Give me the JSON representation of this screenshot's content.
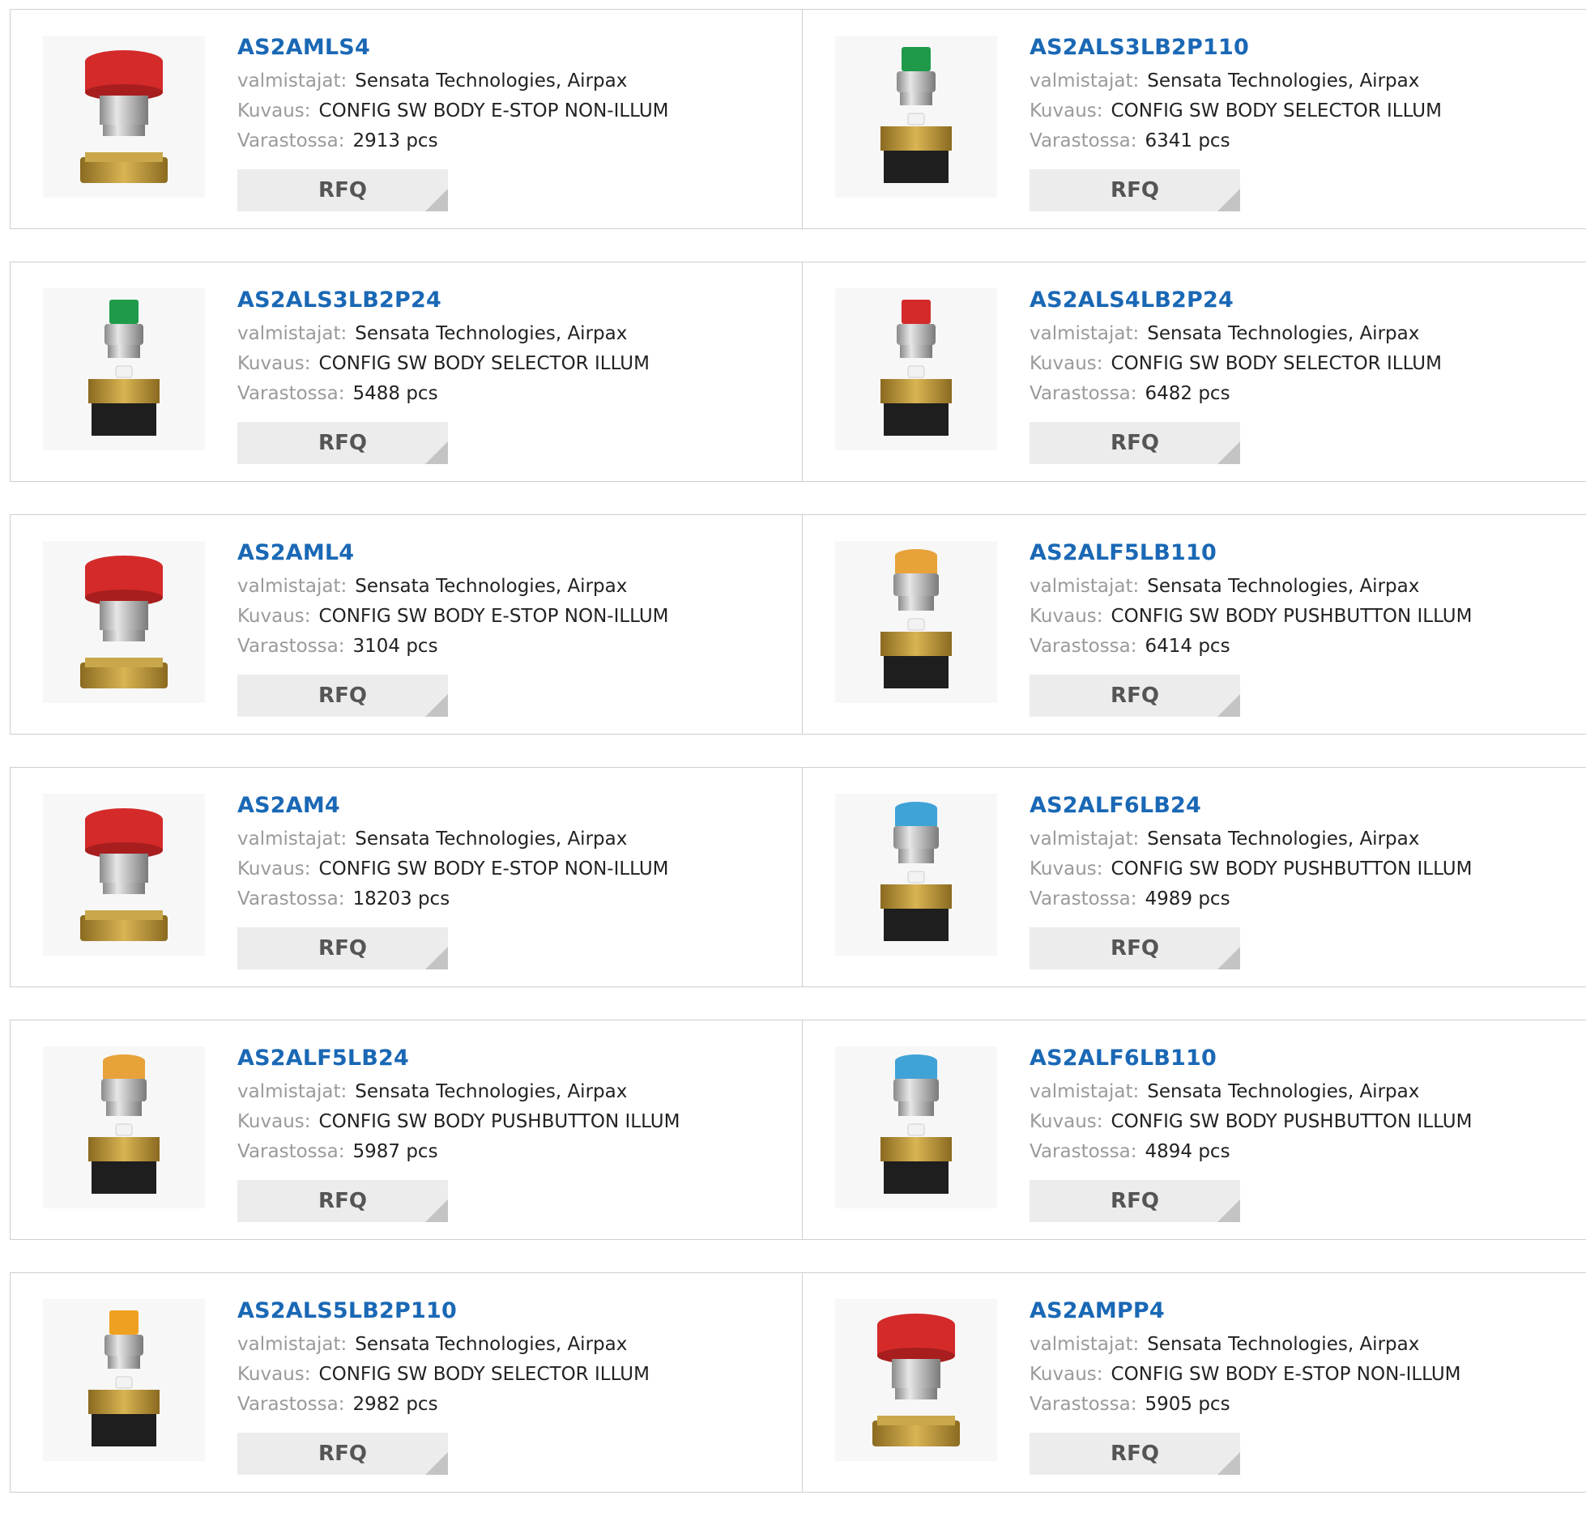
{
  "labels": {
    "manufacturer": "valmistajat:",
    "description": "Kuvaus:",
    "stock": "Varastossa:",
    "rfq": "RFQ"
  },
  "products": [
    {
      "part": "AS2AMLS4",
      "manufacturer": "Sensata Technologies, Airpax",
      "description": "CONFIG SW BODY E-STOP NON-ILLUM",
      "stock": "2913 pcs",
      "image": "estop-red-illustration",
      "cap_color": "#d42a2a",
      "style": "estop"
    },
    {
      "part": "AS2ALS3LB2P110",
      "manufacturer": "Sensata Technologies, Airpax",
      "description": "CONFIG SW BODY SELECTOR ILLUM",
      "stock": "6341 pcs",
      "image": "selector-green-illustration",
      "cap_color": "#1f9a4a",
      "style": "selector"
    },
    {
      "part": "AS2ALS3LB2P24",
      "manufacturer": "Sensata Technologies, Airpax",
      "description": "CONFIG SW BODY SELECTOR ILLUM",
      "stock": "5488 pcs",
      "image": "selector-green-illustration",
      "cap_color": "#1f9a4a",
      "style": "selector"
    },
    {
      "part": "AS2ALS4LB2P24",
      "manufacturer": "Sensata Technologies, Airpax",
      "description": "CONFIG SW BODY SELECTOR ILLUM",
      "stock": "6482 pcs",
      "image": "selector-red-illustration",
      "cap_color": "#d42a2a",
      "style": "selector"
    },
    {
      "part": "AS2AML4",
      "manufacturer": "Sensata Technologies, Airpax",
      "description": "CONFIG SW BODY E-STOP NON-ILLUM",
      "stock": "3104 pcs",
      "image": "estop-red-illustration",
      "cap_color": "#d42a2a",
      "style": "estop"
    },
    {
      "part": "AS2ALF5LB110",
      "manufacturer": "Sensata Technologies, Airpax",
      "description": "CONFIG SW BODY PUSHBUTTON ILLUM",
      "stock": "6414 pcs",
      "image": "pushbutton-amber-illustration",
      "cap_color": "#e8a23a",
      "style": "pushbutton"
    },
    {
      "part": "AS2AM4",
      "manufacturer": "Sensata Technologies, Airpax",
      "description": "CONFIG SW BODY E-STOP NON-ILLUM",
      "stock": "18203 pcs",
      "image": "estop-red-illustration",
      "cap_color": "#d42a2a",
      "style": "estop"
    },
    {
      "part": "AS2ALF6LB24",
      "manufacturer": "Sensata Technologies, Airpax",
      "description": "CONFIG SW BODY PUSHBUTTON ILLUM",
      "stock": "4989 pcs",
      "image": "pushbutton-blue-illustration",
      "cap_color": "#3fa3d8",
      "style": "pushbutton"
    },
    {
      "part": "AS2ALF5LB24",
      "manufacturer": "Sensata Technologies, Airpax",
      "description": "CONFIG SW BODY PUSHBUTTON ILLUM",
      "stock": "5987 pcs",
      "image": "pushbutton-amber-illustration",
      "cap_color": "#e8a23a",
      "style": "pushbutton"
    },
    {
      "part": "AS2ALF6LB110",
      "manufacturer": "Sensata Technologies, Airpax",
      "description": "CONFIG SW BODY PUSHBUTTON ILLUM",
      "stock": "4894 pcs",
      "image": "pushbutton-blue-illustration",
      "cap_color": "#3fa3d8",
      "style": "pushbutton"
    },
    {
      "part": "AS2ALS5LB2P110",
      "manufacturer": "Sensata Technologies, Airpax",
      "description": "CONFIG SW BODY SELECTOR ILLUM",
      "stock": "2982 pcs",
      "image": "selector-amber-illustration",
      "cap_color": "#f0a020",
      "style": "selector"
    },
    {
      "part": "AS2AMPP4",
      "manufacturer": "Sensata Technologies, Airpax",
      "description": "CONFIG SW BODY E-STOP NON-ILLUM",
      "stock": "5905 pcs",
      "image": "estop-red-illustration",
      "cap_color": "#d42a2a",
      "style": "estop"
    }
  ]
}
